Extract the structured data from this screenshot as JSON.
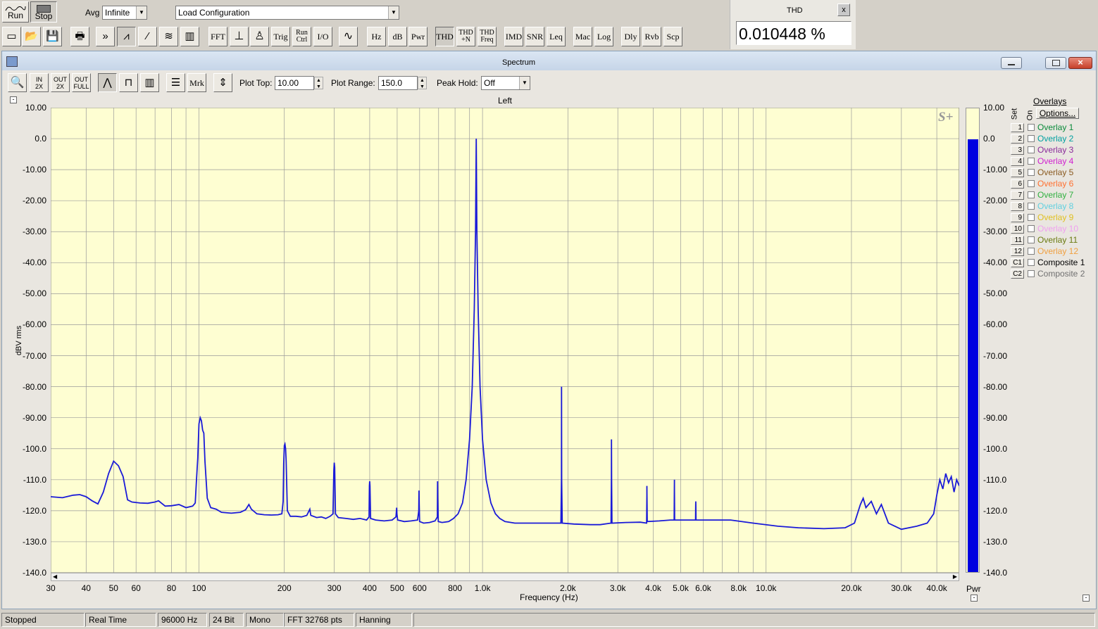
{
  "toolbar": {
    "run_label": "Run",
    "stop_label": "Stop",
    "avg_label": "Avg",
    "avg_value": "Infinite",
    "config_value": "Load Configuration",
    "buttons": [
      "FFT",
      "Trig",
      "Run\nCtrl",
      "I/O",
      "Hz",
      "dB",
      "Pwr",
      "THD",
      "THD\n+N",
      "THD\nFreq",
      "IMD",
      "SNR",
      "Leq",
      "Mac",
      "Log",
      "Dly",
      "Rvb",
      "Scp"
    ]
  },
  "thd_panel": {
    "title": "THD",
    "close": "x",
    "value": "0.010448 %"
  },
  "window": {
    "title": "Spectrum",
    "plot_top_label": "Plot Top:",
    "plot_top_value": "10.00",
    "plot_range_label": "Plot Range:",
    "plot_range_value": "150.0",
    "peak_hold_label": "Peak Hold:",
    "peak_hold_value": "Off",
    "mrk_label": "Mrk",
    "zoom_labels": [
      "IN\n2X",
      "OUT\n2X",
      "OUT\nFULL"
    ]
  },
  "meter": {
    "label": "Pwr",
    "level_db": 0.0,
    "scale_labels": [
      "10.00",
      "0.0",
      "-10.00",
      "-20.00",
      "-30.00",
      "-40.00",
      "-50.00",
      "-60.00",
      "-70.00",
      "-80.00",
      "-90.00",
      "-100.0",
      "-110.0",
      "-120.0",
      "-130.0",
      "-140.0"
    ]
  },
  "overlays": {
    "title": "Overlays",
    "set_label": "Set",
    "on_label": "On",
    "options_label": "Options...",
    "items": [
      {
        "num": "1",
        "name": "Overlay 1",
        "color": "#0a8a3a"
      },
      {
        "num": "2",
        "name": "Overlay 2",
        "color": "#00a0a0"
      },
      {
        "num": "3",
        "name": "Overlay 3",
        "color": "#8a2a9a"
      },
      {
        "num": "4",
        "name": "Overlay 4",
        "color": "#d020d0"
      },
      {
        "num": "5",
        "name": "Overlay 5",
        "color": "#8a5a20"
      },
      {
        "num": "6",
        "name": "Overlay 6",
        "color": "#ff7030"
      },
      {
        "num": "7",
        "name": "Overlay 7",
        "color": "#30b040"
      },
      {
        "num": "8",
        "name": "Overlay 8",
        "color": "#60d0e0"
      },
      {
        "num": "9",
        "name": "Overlay 9",
        "color": "#e0c020"
      },
      {
        "num": "10",
        "name": "Overlay 10",
        "color": "#f0a0f0"
      },
      {
        "num": "11",
        "name": "Overlay 11",
        "color": "#6a7a10"
      },
      {
        "num": "12",
        "name": "Overlay 12",
        "color": "#f0a040"
      },
      {
        "num": "C1",
        "name": "Composite 1",
        "color": "#000000"
      },
      {
        "num": "C2",
        "name": "Composite 2",
        "color": "#707070"
      }
    ]
  },
  "status": [
    "Stopped",
    "Real Time",
    "96000 Hz",
    "24 Bit",
    "Mono",
    "FFT 32768 pts",
    "Hanning"
  ],
  "chart_data": {
    "type": "line",
    "title": "Left",
    "xlabel": "Frequency (Hz)",
    "ylabel": "dBV rms",
    "x_scale": "log",
    "xlim": [
      30,
      48000
    ],
    "ylim": [
      -140,
      10
    ],
    "grid": true,
    "badge": "S+",
    "line_color": "#1a1ad8",
    "y_tick_labels": [
      "10.00",
      "0.0",
      "-10.00",
      "-20.00",
      "-30.00",
      "-40.00",
      "-50.00",
      "-60.00",
      "-70.00",
      "-80.00",
      "-90.00",
      "-100.0",
      "-110.0",
      "-120.0",
      "-130.0",
      "-140.0"
    ],
    "x_tick_values": [
      30,
      40,
      50,
      60,
      80,
      100,
      200,
      300,
      400,
      500,
      600,
      800,
      1000,
      2000,
      3000,
      4000,
      5000,
      6000,
      8000,
      10000,
      20000,
      30000,
      40000
    ],
    "x_tick_labels": [
      "30",
      "40",
      "50",
      "60",
      "80",
      "100",
      "200",
      "300",
      "400",
      "500",
      "600",
      "800",
      "1.0k",
      "2.0k",
      "3.0k",
      "4.0k",
      "5.0k",
      "6.0k",
      "8.0k",
      "10.0k",
      "20.0k",
      "30.0k",
      "40.0k"
    ],
    "series": [
      {
        "points": [
          [
            30,
            -115.5
          ],
          [
            33,
            -115.8
          ],
          [
            36,
            -115
          ],
          [
            38,
            -114.8
          ],
          [
            40,
            -115.5
          ],
          [
            42,
            -116.8
          ],
          [
            44,
            -117.8
          ],
          [
            46,
            -114
          ],
          [
            48,
            -108
          ],
          [
            50,
            -104
          ],
          [
            52,
            -105.5
          ],
          [
            54,
            -109
          ],
          [
            56,
            -116.5
          ],
          [
            58,
            -117.2
          ],
          [
            62,
            -117.5
          ],
          [
            66,
            -117.6
          ],
          [
            70,
            -117.2
          ],
          [
            72,
            -116.8
          ],
          [
            76,
            -118.5
          ],
          [
            80,
            -118.4
          ],
          [
            85,
            -118
          ],
          [
            90,
            -119
          ],
          [
            95,
            -118.5
          ],
          [
            97,
            -117.5
          ],
          [
            98,
            -110
          ],
          [
            99,
            -103
          ],
          [
            100,
            -92
          ],
          [
            101,
            -90
          ],
          [
            102,
            -91
          ],
          [
            103,
            -94
          ],
          [
            104,
            -95
          ],
          [
            105,
            -104
          ],
          [
            107,
            -116
          ],
          [
            110,
            -119
          ],
          [
            115,
            -119.5
          ],
          [
            120,
            -120.5
          ],
          [
            130,
            -120.8
          ],
          [
            140,
            -120.5
          ],
          [
            146,
            -119.7
          ],
          [
            150,
            -118
          ],
          [
            153,
            -119.5
          ],
          [
            160,
            -121
          ],
          [
            170,
            -121.3
          ],
          [
            180,
            -121.4
          ],
          [
            190,
            -121.3
          ],
          [
            196,
            -121
          ],
          [
            198,
            -117
          ],
          [
            199,
            -105
          ],
          [
            200,
            -99
          ],
          [
            201,
            -98.5
          ],
          [
            202,
            -100
          ],
          [
            203,
            -104
          ],
          [
            205,
            -120
          ],
          [
            210,
            -121.8
          ],
          [
            220,
            -121.8
          ],
          [
            230,
            -122
          ],
          [
            240,
            -121.5
          ],
          [
            246,
            -119.5
          ],
          [
            248,
            -121.5
          ],
          [
            260,
            -122.2
          ],
          [
            270,
            -122
          ],
          [
            280,
            -122.5
          ],
          [
            290,
            -121.8
          ],
          [
            297,
            -121
          ],
          [
            299,
            -107
          ],
          [
            300,
            -104.5
          ],
          [
            301,
            -106
          ],
          [
            303,
            -121
          ],
          [
            310,
            -122.2
          ],
          [
            330,
            -122.5
          ],
          [
            350,
            -122.8
          ],
          [
            370,
            -122.5
          ],
          [
            390,
            -123
          ],
          [
            398,
            -122
          ],
          [
            399,
            -112
          ],
          [
            400,
            -110.5
          ],
          [
            401,
            -112
          ],
          [
            403,
            -122.5
          ],
          [
            420,
            -123
          ],
          [
            450,
            -123.3
          ],
          [
            480,
            -123
          ],
          [
            495,
            -122
          ],
          [
            497,
            -120
          ],
          [
            498,
            -119
          ],
          [
            499,
            -121
          ],
          [
            502,
            -123
          ],
          [
            530,
            -123.5
          ],
          [
            560,
            -123.3
          ],
          [
            590,
            -123
          ],
          [
            596,
            -120
          ],
          [
            597,
            -113.5
          ],
          [
            598,
            -118
          ],
          [
            600,
            -123.5
          ],
          [
            620,
            -124
          ],
          [
            650,
            -123.8
          ],
          [
            680,
            -123.3
          ],
          [
            693,
            -122
          ],
          [
            694,
            -110.5
          ],
          [
            695,
            -116
          ],
          [
            698,
            -123.5
          ],
          [
            720,
            -123.8
          ],
          [
            760,
            -123.5
          ],
          [
            790,
            -122.5
          ],
          [
            820,
            -121
          ],
          [
            850,
            -117.5
          ],
          [
            875,
            -110
          ],
          [
            900,
            -97
          ],
          [
            920,
            -80
          ],
          [
            935,
            -55
          ],
          [
            945,
            -30
          ],
          [
            950,
            0
          ],
          [
            955,
            -30
          ],
          [
            965,
            -55
          ],
          [
            980,
            -80
          ],
          [
            1000,
            -97
          ],
          [
            1030,
            -110
          ],
          [
            1070,
            -117.5
          ],
          [
            1110,
            -121
          ],
          [
            1150,
            -122.5
          ],
          [
            1200,
            -123.5
          ],
          [
            1300,
            -124
          ],
          [
            1500,
            -124
          ],
          [
            1700,
            -124
          ],
          [
            1890,
            -124
          ],
          [
            1898,
            -110
          ],
          [
            1900,
            -80
          ],
          [
            1902,
            -110
          ],
          [
            1910,
            -124
          ],
          [
            2100,
            -124.3
          ],
          [
            2400,
            -124.5
          ],
          [
            2600,
            -124.5
          ],
          [
            2840,
            -124
          ],
          [
            2848,
            -110
          ],
          [
            2850,
            -97
          ],
          [
            2852,
            -110
          ],
          [
            2860,
            -124
          ],
          [
            3200,
            -123.8
          ],
          [
            3600,
            -123.7
          ],
          [
            3790,
            -124
          ],
          [
            3798,
            -115
          ],
          [
            3800,
            -112
          ],
          [
            3802,
            -115
          ],
          [
            3810,
            -123.5
          ],
          [
            4200,
            -123.3
          ],
          [
            4600,
            -123
          ],
          [
            4740,
            -123
          ],
          [
            4748,
            -113
          ],
          [
            4750,
            -110
          ],
          [
            4752,
            -113
          ],
          [
            4760,
            -123
          ],
          [
            5200,
            -123
          ],
          [
            5640,
            -123
          ],
          [
            5648,
            -118
          ],
          [
            5650,
            -117
          ],
          [
            5652,
            -118
          ],
          [
            5660,
            -123
          ],
          [
            6500,
            -123
          ],
          [
            7500,
            -123
          ],
          [
            9000,
            -124
          ],
          [
            11000,
            -125
          ],
          [
            13000,
            -125.5
          ],
          [
            16000,
            -125.8
          ],
          [
            19000,
            -125.5
          ],
          [
            20500,
            -124
          ],
          [
            21500,
            -118
          ],
          [
            22000,
            -116
          ],
          [
            22500,
            -119
          ],
          [
            23500,
            -117
          ],
          [
            24500,
            -121
          ],
          [
            25500,
            -118
          ],
          [
            27000,
            -124
          ],
          [
            30000,
            -126
          ],
          [
            34000,
            -125
          ],
          [
            37000,
            -124
          ],
          [
            39000,
            -121
          ],
          [
            40000,
            -115
          ],
          [
            41000,
            -110
          ],
          [
            42000,
            -113
          ],
          [
            43000,
            -108
          ],
          [
            44000,
            -111
          ],
          [
            45000,
            -109
          ],
          [
            46000,
            -114
          ],
          [
            47000,
            -110
          ],
          [
            48000,
            -112
          ]
        ]
      }
    ]
  }
}
